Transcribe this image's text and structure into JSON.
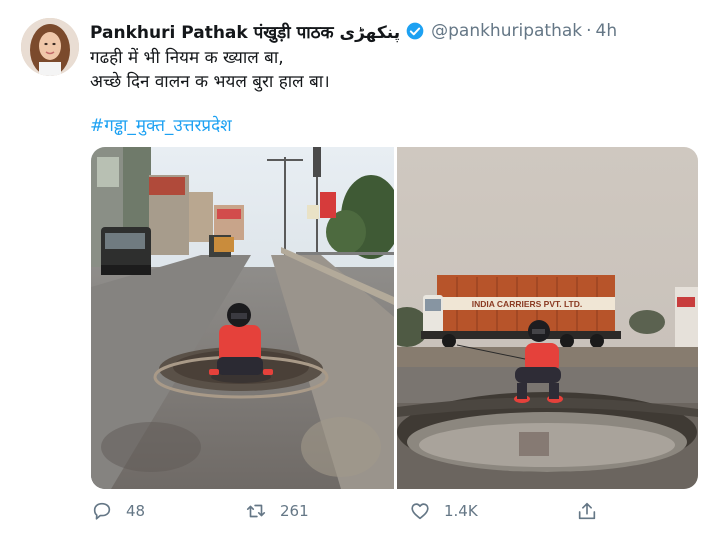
{
  "tweet": {
    "display_name": "Pankhuri Pathak पंखुड़ी पाठक پنکھڑی",
    "handle": "@pankhuripathak",
    "separator": "·",
    "time": "4h",
    "text_line1": "गढही में भी नियम क ख्याल बा,",
    "text_line2": "अच्छे दिन वालन क भयल बुरा हाल बा।",
    "hashtag": "#गड्ढा_मुक्त_उत्तरप्रदेश"
  },
  "media": {
    "left_truck_text": "",
    "right_truck_text": "INDIA CARRIERS PVT. LTD."
  },
  "actions": {
    "reply_count": "48",
    "retweet_count": "261",
    "like_count": "1.4K"
  },
  "colors": {
    "accent": "#1da1f2",
    "muted": "#657786",
    "text": "#14171a"
  },
  "icons": {
    "verified": "verified-badge-icon",
    "reply": "reply-icon",
    "retweet": "retweet-icon",
    "like": "heart-icon",
    "share": "share-icon"
  }
}
